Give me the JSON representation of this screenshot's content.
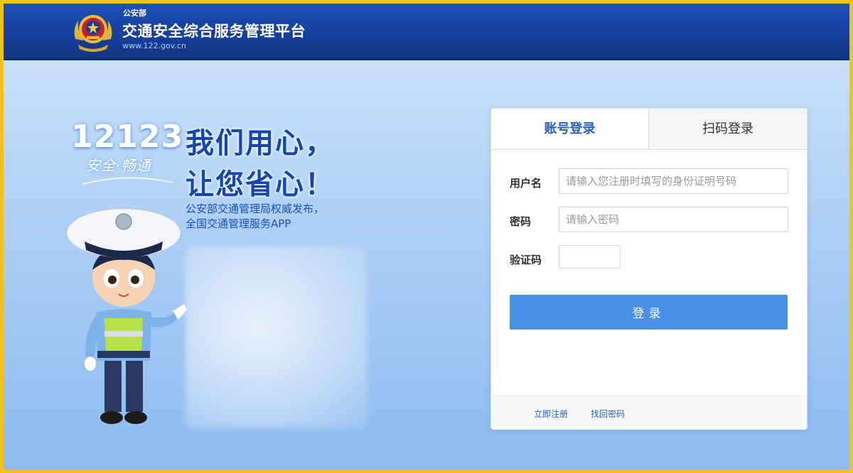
{
  "header": {
    "ministry": "公安部",
    "platform_title": "交通安全综合服务管理平台",
    "site_url": "www.122.gov.cn",
    "emblem_icon": "police-emblem-icon"
  },
  "hero": {
    "number": "12123",
    "motto": "安全·畅通",
    "slogan_line1": "我们用心，",
    "slogan_line2": "让您省心！",
    "desc_line1": "公安部交通管理局权威发布，",
    "desc_line2": "全国交通管理服务APP"
  },
  "login": {
    "tabs": [
      {
        "label": "账号登录",
        "active": true
      },
      {
        "label": "扫码登录",
        "active": false
      }
    ],
    "username_label": "用户名",
    "username_placeholder": "请输入您注册时填写的身份证明号码",
    "password_label": "密码",
    "password_placeholder": "请输入密码",
    "captcha_label": "验证码",
    "captcha_value": "",
    "submit_label": "登录",
    "footer_links": [
      "立即注册",
      "找回密码"
    ]
  },
  "colors": {
    "header": "#163e9c",
    "accent": "#4c8fe6",
    "link": "#2a5fbd",
    "frame_border": "#f3c21a"
  }
}
